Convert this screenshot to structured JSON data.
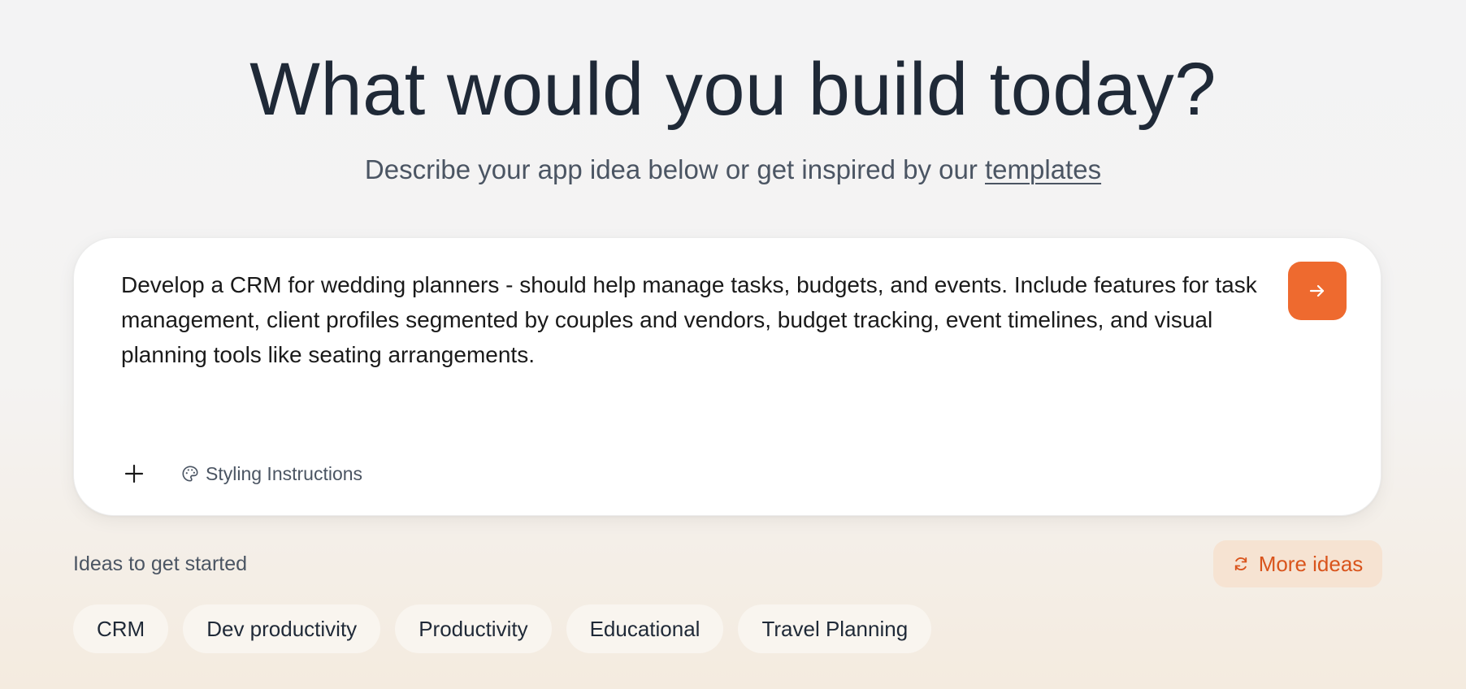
{
  "hero": {
    "title": "What would you build today?",
    "subtitle_prefix": "Describe your app idea below or get inspired by our ",
    "subtitle_link": "templates"
  },
  "prompt": {
    "text": "Develop a CRM for wedding planners - should help manage tasks, budgets, and events. Include features for task management, client profiles segmented by couples and vendors, budget tracking, event timelines, and visual planning tools like seating arrangements.",
    "send_icon": "arrow-right-icon",
    "add_icon": "plus-icon",
    "styling_label": "Styling Instructions",
    "styling_icon": "palette-icon"
  },
  "ideas": {
    "label": "Ideas to get started",
    "more_label": "More ideas",
    "more_icon": "refresh-icon",
    "chips": [
      "CRM",
      "Dev productivity",
      "Productivity",
      "Educational",
      "Travel Planning"
    ]
  },
  "colors": {
    "accent": "#ee6a2f",
    "accent_soft": "#f6e3d2",
    "accent_text": "#d9541c",
    "heading": "#1f2937",
    "muted": "#4b5563"
  }
}
